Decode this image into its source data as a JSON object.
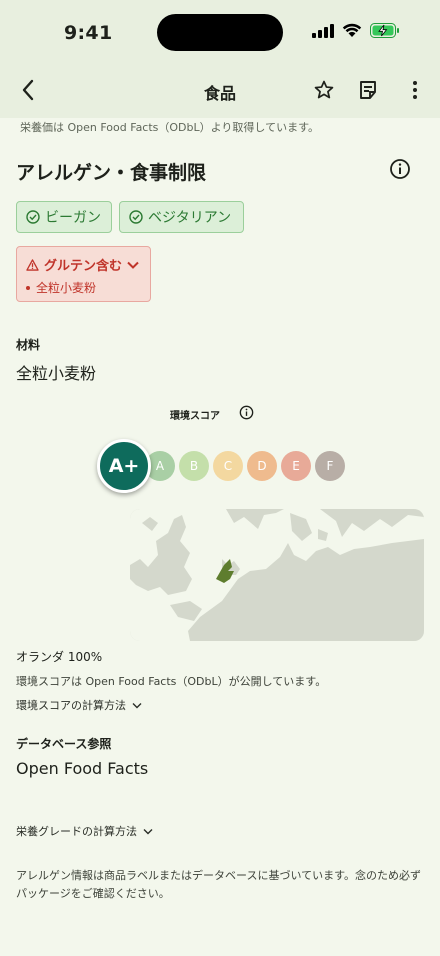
{
  "status_bar": {
    "time": "9:41"
  },
  "app_bar": {
    "title": "食品"
  },
  "nutrition_source_note": "栄養価は Open Food Facts（ODbL）より取得しています。",
  "allergen_section": {
    "title": "アレルゲン・食事制限",
    "chips": [
      "ビーガン",
      "ベジタリアン"
    ],
    "warning": {
      "title": "グルテン含む",
      "items": [
        "全粒小麦粉"
      ]
    }
  },
  "ingredients": {
    "label": "材料",
    "value": "全粒小麦粉"
  },
  "eco_score": {
    "label": "環境スコア",
    "current": "A+",
    "grades": [
      {
        "grade": "A",
        "color": "#a9cfa5"
      },
      {
        "grade": "B",
        "color": "#c4dfaa"
      },
      {
        "grade": "C",
        "color": "#f3d8a0"
      },
      {
        "grade": "D",
        "color": "#efbb8e"
      },
      {
        "grade": "E",
        "color": "#e8aa98"
      },
      {
        "grade": "F",
        "color": "#b8aea6"
      }
    ],
    "origin": "オランダ 100%",
    "source_note": "環境スコアは Open Food Facts（ODbL）が公開しています。",
    "calc_link": "環境スコアの計算方法"
  },
  "database": {
    "label": "データベース参照",
    "value": "Open Food Facts"
  },
  "nutrition_grade_link": "栄養グレードの計算方法",
  "disclaimer": "アレルゲン情報は商品ラベルまたはデータベースに基づいています。念のため必ずパッケージをご確認ください。"
}
